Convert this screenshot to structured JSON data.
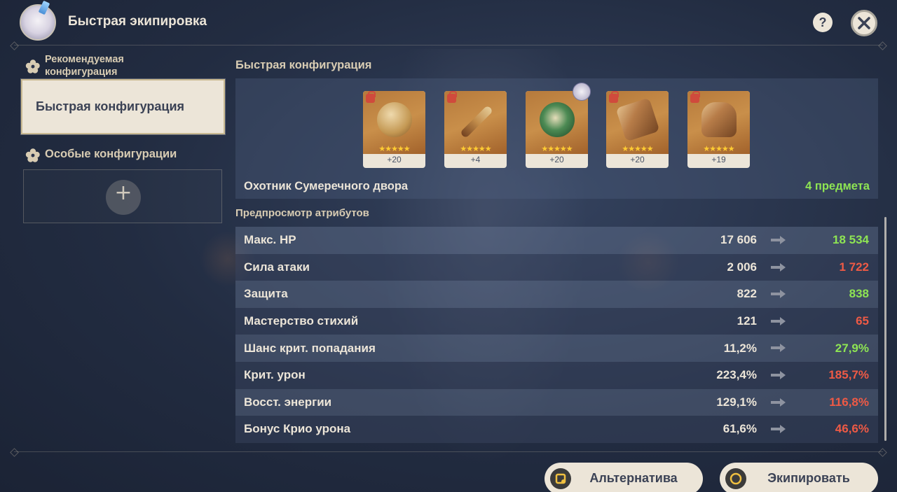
{
  "app": {
    "title": "Быстрая экипировка"
  },
  "header": {
    "help_label": "?",
    "help_icon": "question-icon",
    "close_icon": "close-icon"
  },
  "sidebar": {
    "recommended_heading": "Рекомендуемая конфигурация",
    "active_item": "Быстрая конфигурация",
    "special_heading": "Особые конфигурации",
    "add_label": "+"
  },
  "main": {
    "quick_title": "Быстрая конфигурация",
    "artifacts": [
      {
        "name": "flower-artifact",
        "stars": "★★★★★",
        "level": "+20",
        "locked": true
      },
      {
        "name": "plume-artifact",
        "stars": "★★★★★",
        "level": "+4",
        "locked": true
      },
      {
        "name": "sands-artifact",
        "stars": "★★★★★",
        "level": "+20",
        "locked": false,
        "equipped_by_other": true
      },
      {
        "name": "goblet-artifact",
        "stars": "★★★★★",
        "level": "+20",
        "locked": true
      },
      {
        "name": "circlet-artifact",
        "stars": "★★★★★",
        "level": "+19",
        "locked": true
      }
    ],
    "set_name": "Охотник Сумеречного двора",
    "set_count": "4 предмета",
    "preview_title": "Предпросмотр атрибутов",
    "stats": [
      {
        "label": "Макс. HP",
        "current": "17 606",
        "new": "18 534",
        "trend": "up"
      },
      {
        "label": "Сила атаки",
        "current": "2 006",
        "new": "1 722",
        "trend": "down"
      },
      {
        "label": "Защита",
        "current": "822",
        "new": "838",
        "trend": "up"
      },
      {
        "label": "Мастерство стихий",
        "current": "121",
        "new": "65",
        "trend": "down"
      },
      {
        "label": "Шанс крит. попадания",
        "current": "11,2%",
        "new": "27,9%",
        "trend": "up"
      },
      {
        "label": "Крит. урон",
        "current": "223,4%",
        "new": "185,7%",
        "trend": "down"
      },
      {
        "label": "Восст. энергии",
        "current": "129,1%",
        "new": "116,8%",
        "trend": "down"
      },
      {
        "label": "Бонус Крио урона",
        "current": "61,6%",
        "new": "46,6%",
        "trend": "down"
      }
    ]
  },
  "footer": {
    "alternative_label": "Альтернатива",
    "equip_label": "Экипировать"
  },
  "colors": {
    "background": "#222c41",
    "panel_text": "#ece5d8",
    "stat_up": "#8ee553",
    "stat_down": "#ef5a45",
    "star": "#ffcc32"
  }
}
